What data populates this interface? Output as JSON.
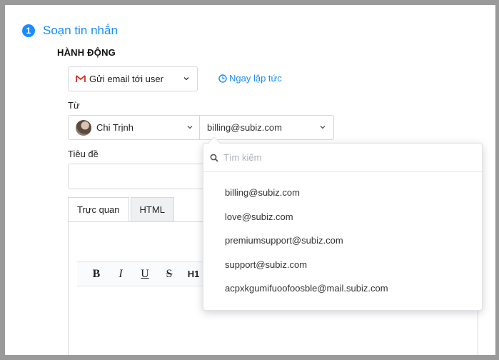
{
  "step": {
    "number": "1",
    "title": "Soạn tin nhắn"
  },
  "action": {
    "section_label": "HÀNH ĐỘNG",
    "selected": "Gửi email tới user",
    "timing": "Ngay lập tức"
  },
  "from": {
    "label": "Từ",
    "agent": "Chi Trịnh",
    "email": "billing@subiz.com"
  },
  "subject": {
    "label": "Tiêu đề",
    "value": ""
  },
  "editor": {
    "tabs": [
      "Trực quan",
      "HTML"
    ],
    "toolbar": [
      "B",
      "I",
      "U",
      "S",
      "H1"
    ]
  },
  "email_dropdown": {
    "search_placeholder": "Tìm kiếm",
    "options": [
      "billing@subiz.com",
      "love@subiz.com",
      "premiumsupport@subiz.com",
      "support@subiz.com",
      "acpxkgumifuoofoosble@mail.subiz.com"
    ]
  },
  "colors": {
    "accent": "#1a8cff",
    "border": "#d5d8dc",
    "gmail_red": "#d93025"
  }
}
